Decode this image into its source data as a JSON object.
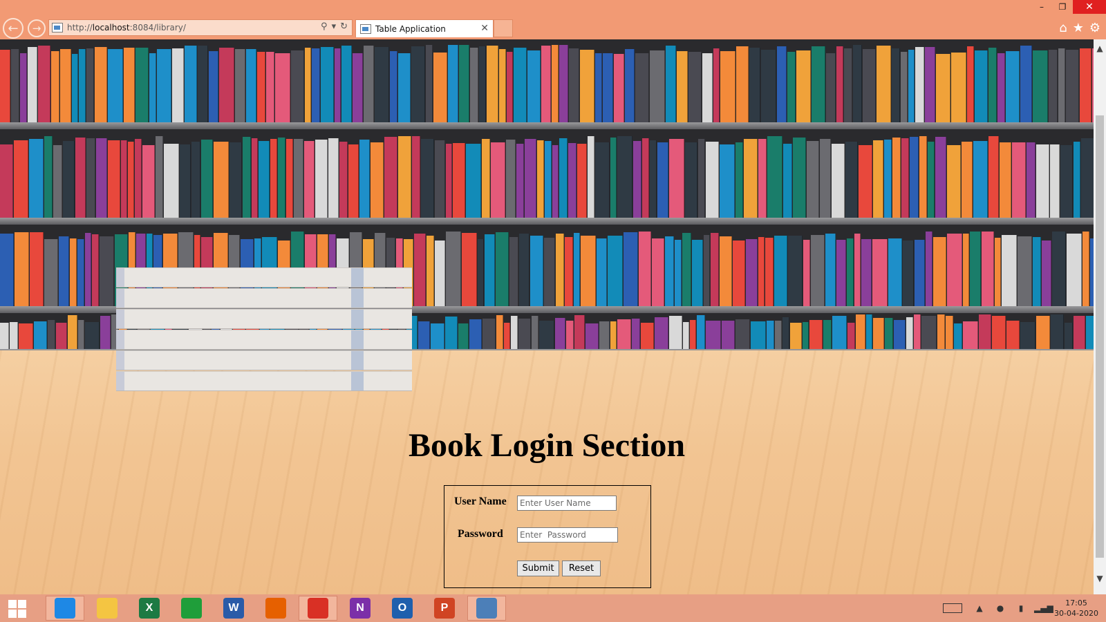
{
  "browser": {
    "url_prefix": "http://",
    "url_host": "localhost",
    "url_rest": ":8084/library/",
    "tab_title": "Table Application"
  },
  "login": {
    "title": "Book Login Section",
    "username_label": "User Name",
    "username_placeholder": "Enter User Name",
    "password_label": "Password",
    "password_placeholder": "Enter  Password",
    "submit_label": "Submit",
    "reset_label": "Reset"
  },
  "taskbar": {
    "apps": [
      {
        "icon": "internet-explorer-icon",
        "label": "",
        "color": "#1e88e5",
        "active": true
      },
      {
        "icon": "file-explorer-icon",
        "label": "",
        "color": "#f4c542",
        "active": false
      },
      {
        "icon": "excel-icon",
        "label": "X",
        "color": "#1d7a43",
        "active": false
      },
      {
        "icon": "store-icon",
        "label": "",
        "color": "#1f9e3a",
        "active": false
      },
      {
        "icon": "word-icon",
        "label": "W",
        "color": "#2a5ba8",
        "active": false
      },
      {
        "icon": "firefox-icon",
        "label": "",
        "color": "#e66000",
        "active": false
      },
      {
        "icon": "chrome-icon",
        "label": "",
        "color": "#d93025",
        "active": true
      },
      {
        "icon": "onenote-icon",
        "label": "N",
        "color": "#7b2fa8",
        "active": false
      },
      {
        "icon": "outlook-icon",
        "label": "O",
        "color": "#1f5fad",
        "active": false
      },
      {
        "icon": "powerpoint-icon",
        "label": "P",
        "color": "#d04423",
        "active": false
      },
      {
        "icon": "virtualbox-icon",
        "label": "",
        "color": "#4c7fb8",
        "active": true
      }
    ],
    "time": "17:05",
    "date": "30-04-2020"
  }
}
